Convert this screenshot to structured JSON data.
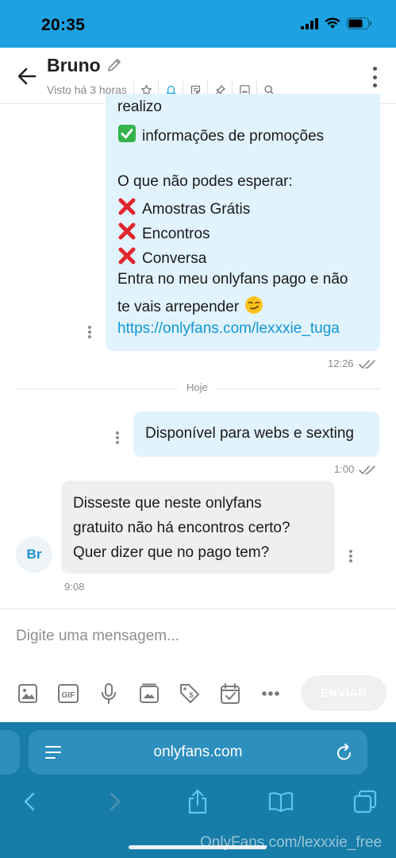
{
  "status_bar": {
    "time": "20:35"
  },
  "header": {
    "name": "Bruno",
    "last_seen": "Visto há 3 horas",
    "icons": [
      "star-icon",
      "bell-icon",
      "note-icon",
      "pin-icon",
      "image-icon",
      "search-icon"
    ]
  },
  "messages": {
    "outgoing_promo": {
      "lines": [
        "realizo",
        "informações de promoções",
        "O que não podes esperar:",
        "Amostras Grátis",
        "Encontros",
        "Conversa",
        "Entra no meu onlyfans pago e não",
        "te vais arrepender",
        "https://onlyfans.com/lexxxie_tuga"
      ],
      "time": "12:26"
    },
    "day_separator": "Hoje",
    "outgoing_small": {
      "text": "Disponível para webs e sexting",
      "time": "1:00"
    },
    "incoming": {
      "lines": [
        "Disseste que neste onlyfans",
        "gratuito não há encontros certo?",
        "Quer dizer que no pago tem?"
      ],
      "time": "9:08",
      "avatar_initials": "Br"
    }
  },
  "composer": {
    "placeholder": "Digite uma mensagem...",
    "send_label": "ENVIAR"
  },
  "browser": {
    "url": "onlyfans.com"
  },
  "watermark": "OnlyFans.com/lexxxie_free",
  "colors": {
    "accent": "#1da1e0",
    "bubble_out": "#e1f3fd",
    "bubble_in": "#efeff0",
    "link": "#1397d4"
  }
}
